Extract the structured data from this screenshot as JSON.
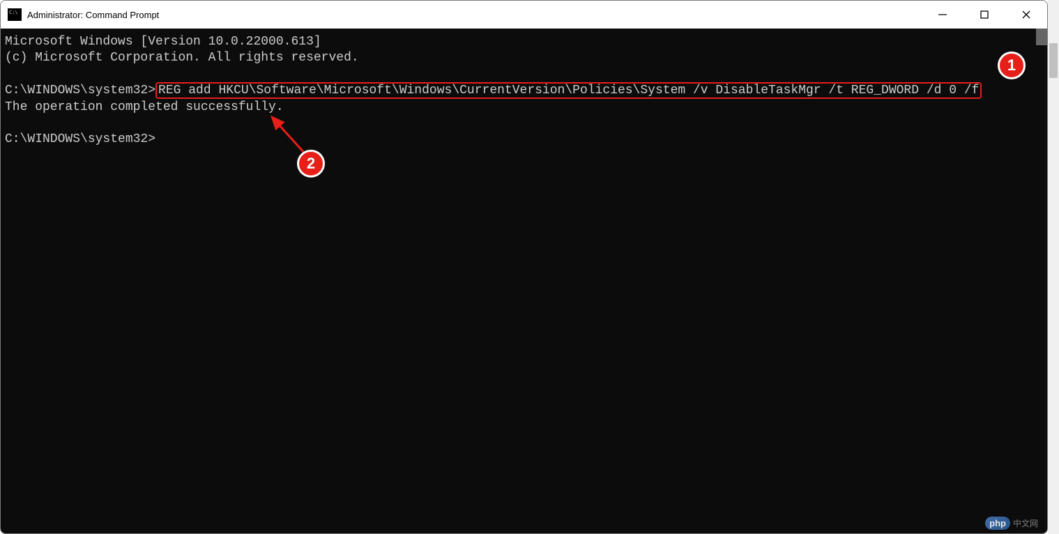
{
  "window": {
    "title": "Administrator: Command Prompt"
  },
  "terminal": {
    "header1": "Microsoft Windows [Version 10.0.22000.613]",
    "header2": "(c) Microsoft Corporation. All rights reserved.",
    "prompt1": "C:\\WINDOWS\\system32>",
    "command": "REG add HKCU\\Software\\Microsoft\\Windows\\CurrentVersion\\Policies\\System /v DisableTaskMgr /t REG_DWORD /d 0 /f",
    "result": "The operation completed successfully.",
    "prompt2": "C:\\WINDOWS\\system32>"
  },
  "annotations": {
    "badge1": "1",
    "badge2": "2"
  },
  "watermark": {
    "logo": "php",
    "text": "中文网"
  }
}
